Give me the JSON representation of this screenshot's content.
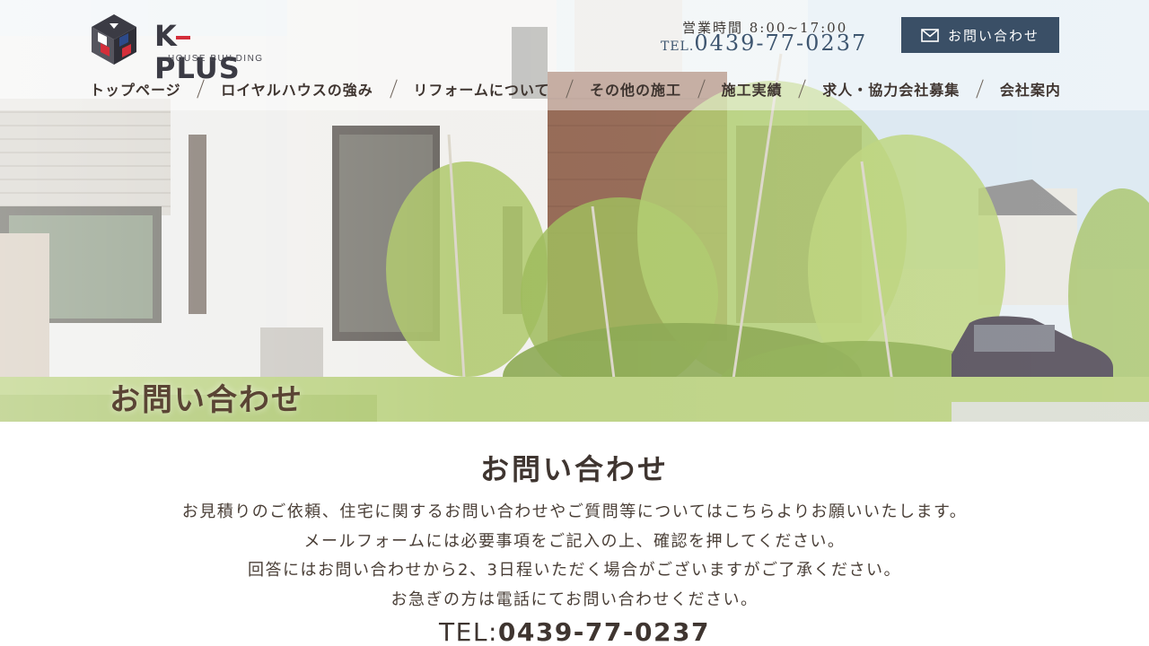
{
  "brand": {
    "name": "K-PLUS",
    "subtitle": "HOUSE BUILDING",
    "colors": {
      "primary": "#3a4f66",
      "text": "#4a3f37",
      "logo_red": "#d42e3a",
      "logo_blue": "#2d4a8a"
    }
  },
  "header": {
    "hours": "営業時間 8:00~17:00",
    "tel_label": "TEL.",
    "tel_number": "0439-77-0237",
    "contact_button": {
      "label": "お問い合わせ",
      "icon": "mail-icon"
    }
  },
  "nav": {
    "items": [
      {
        "label": "トップページ"
      },
      {
        "label": "ロイヤルハウスの強み"
      },
      {
        "label": "リフォームについて"
      },
      {
        "label": "その他の施工"
      },
      {
        "label": "施工実績"
      },
      {
        "label": "求人・協力会社募集"
      },
      {
        "label": "会社案内"
      }
    ]
  },
  "hero": {
    "title": "お問い合わせ"
  },
  "content": {
    "title": "お問い合わせ",
    "lines": [
      "お見積りのご依頼、住宅に関するお問い合わせやご質問等についてはこちらよりお願いいたします。",
      "メールフォームには必要事項をご記入の上、確認を押してください。",
      "回答にはお問い合わせから2、3日程いただく場合がございますがご了承ください。",
      "お急ぎの方は電話にてお問い合わせください。"
    ],
    "tel_label": "TEL:",
    "tel_number": "0439-77-0237"
  }
}
